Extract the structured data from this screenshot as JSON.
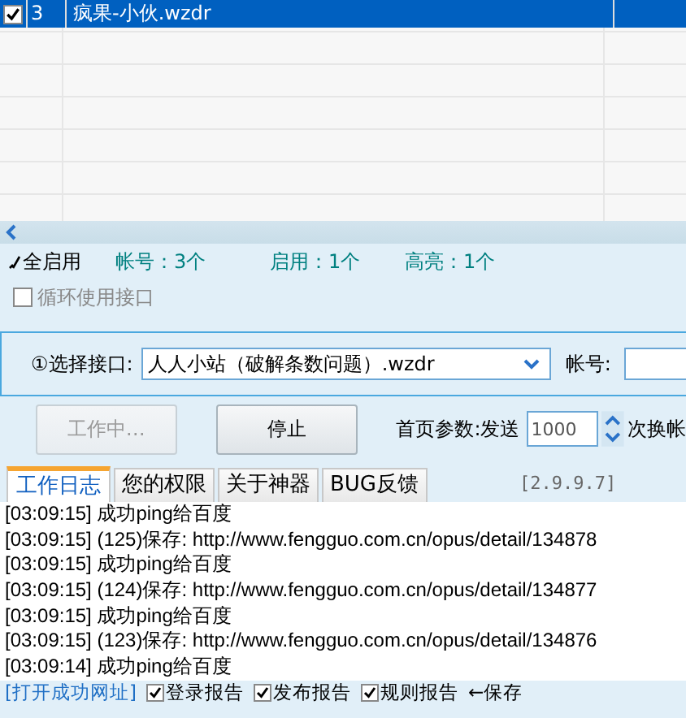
{
  "accounts": [
    {
      "checked": true,
      "number": "3",
      "name": "疯果-小伙.wzdr",
      "selected": true
    }
  ],
  "toolbar": {
    "enable_all": "全启用",
    "stats": [
      "帐号：3个",
      "启用：1个",
      "高亮：1个"
    ]
  },
  "loop_interface": {
    "label": "循环使用接口",
    "checked": false
  },
  "interface": {
    "label": "①选择接口:",
    "value": "人人小站（破解条数问题）.wzdr",
    "account_label": "帐号:"
  },
  "controls": {
    "buttons": [
      {
        "label": "工作中…",
        "disabled": true
      },
      {
        "label": "停止",
        "disabled": false
      }
    ],
    "param_label": "首页参数:发送",
    "param_value": "1000",
    "param_suffix": "次换帐"
  },
  "tabs": [
    {
      "label": "工作日志",
      "selected": true
    },
    {
      "label": "您的权限",
      "selected": false
    },
    {
      "label": "关于神器",
      "selected": false
    },
    {
      "label": "BUG反馈",
      "selected": false
    }
  ],
  "version": "[2.9.9.7]",
  "log": [
    "[03:09:15] 成功ping给百度",
    "[03:09:15] (125)保存: http://www.fengguo.com.cn/opus/detail/134878",
    "[03:09:15] 成功ping给百度",
    "[03:09:15] (124)保存: http://www.fengguo.com.cn/opus/detail/134877",
    "[03:09:15] 成功ping给百度",
    "[03:09:15] (123)保存: http://www.fengguo.com.cn/opus/detail/134876",
    "[03:09:14] 成功ping给百度"
  ],
  "bottom": {
    "link": "[打开成功网址]",
    "reports": [
      {
        "label": "登录报告",
        "checked": true
      },
      {
        "label": "发布报告",
        "checked": true
      },
      {
        "label": "规则报告",
        "checked": true
      }
    ],
    "save": "←保存"
  }
}
